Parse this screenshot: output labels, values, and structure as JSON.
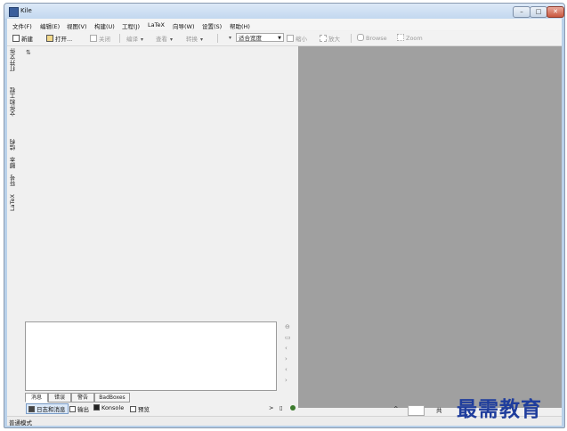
{
  "window": {
    "title": "Kile"
  },
  "menubar": [
    "文件(F)",
    "编辑(E)",
    "视图(V)",
    "构建(U)",
    "工程(J)",
    "LaTeX",
    "向导(W)",
    "设置(S)",
    "帮助(H)"
  ],
  "toolbar": {
    "new": "新建",
    "open": "打开...",
    "close": "关闭",
    "compile": "编译",
    "view": "查看",
    "convert": "转换",
    "zoom_select": "适合宽度",
    "zoom_out": "缩小",
    "zoom_in": "放大",
    "browse": "Browse",
    "zoom": "Zoom"
  },
  "sidebar_tabs": [
    "打开文件",
    "文件和工程",
    "结构",
    "脚本",
    "符号",
    "LaTeX"
  ],
  "log_tabs": [
    "消息",
    "错误",
    "警告",
    "BadBoxes"
  ],
  "bottom_bar": {
    "log": "日志和消息",
    "output": "输出",
    "konsole": "Konsole",
    "preview": "预览"
  },
  "page_label": "共",
  "status": {
    "mode": "普通模式"
  },
  "watermark": "最需教育",
  "icons": [
    "app-icon",
    "new-file-icon",
    "open-folder-icon",
    "close-doc-icon",
    "zoom-out-icon",
    "zoom-in-icon",
    "browse-hand-icon",
    "zoom-tool-icon",
    "log-icon",
    "output-icon",
    "konsole-icon",
    "preview-icon"
  ]
}
